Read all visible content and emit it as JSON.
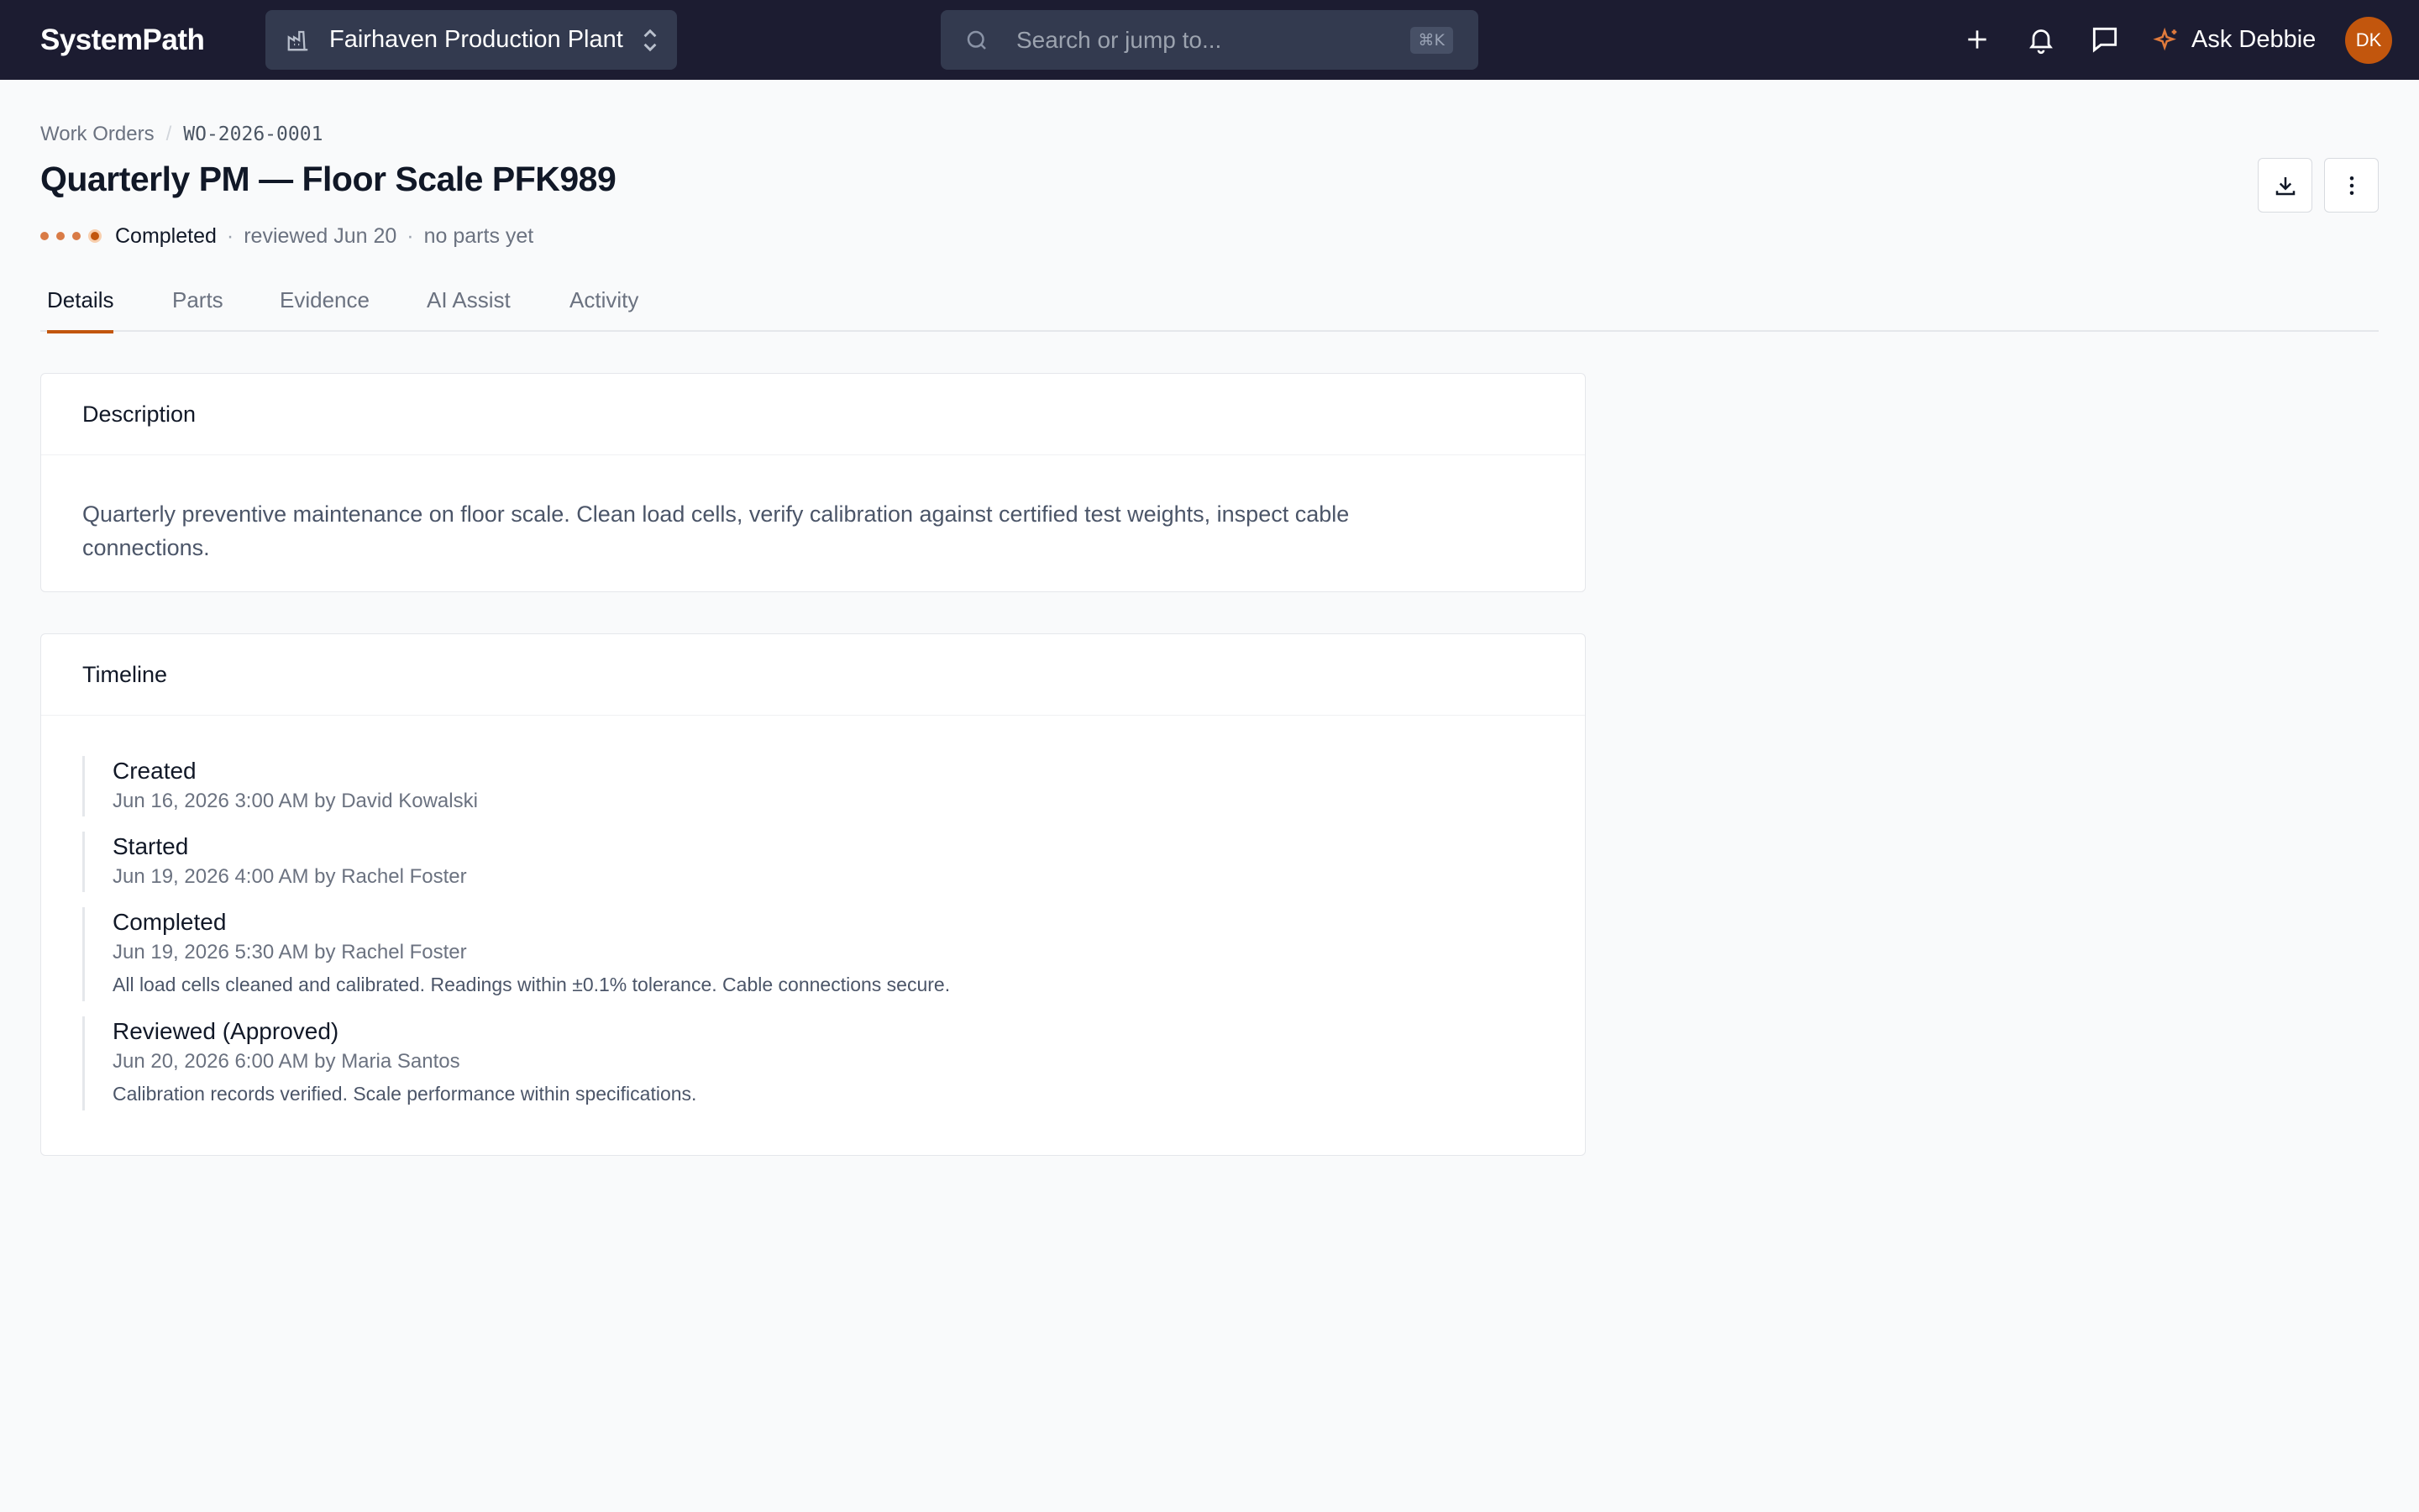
{
  "nav": {
    "brand": "SystemPath",
    "plant": "Fairhaven Production Plant",
    "search_placeholder": "Search or jump to...",
    "search_shortcut": "⌘K",
    "ask_label": "Ask Debbie",
    "avatar_initials": "DK",
    "icons": [
      "plus-icon",
      "bell-icon",
      "chat-icon",
      "sparkle-icon"
    ]
  },
  "breadcrumb": {
    "parent": "Work Orders",
    "separator": "/",
    "current": "WO-2026-0001"
  },
  "header": {
    "title": "Quarterly PM — Floor Scale PFK989",
    "status": "Completed",
    "separator": "·",
    "reviewed": "reviewed Jun 20",
    "parts": "no parts yet",
    "progress_steps_total": 4,
    "progress_steps_done": 4
  },
  "tabs": [
    {
      "label": "Details",
      "active": true
    },
    {
      "label": "Parts",
      "active": false
    },
    {
      "label": "Evidence",
      "active": false
    },
    {
      "label": "AI Assist",
      "active": false
    },
    {
      "label": "Activity",
      "active": false
    }
  ],
  "description": {
    "heading": "Description",
    "text": "Quarterly preventive maintenance on floor scale. Clean load cells, verify calibration against certified test weights, inspect cable connections."
  },
  "timeline": {
    "heading": "Timeline",
    "events": [
      {
        "title": "Created",
        "meta": "Jun 16, 2026 3:00 AM by David Kowalski",
        "note": ""
      },
      {
        "title": "Started",
        "meta": "Jun 19, 2026 4:00 AM by Rachel Foster",
        "note": ""
      },
      {
        "title": "Completed",
        "meta": "Jun 19, 2026 5:30 AM by Rachel Foster",
        "note": "All load cells cleaned and calibrated. Readings within ±0.1% tolerance. Cable connections secure."
      },
      {
        "title": "Reviewed (Approved)",
        "meta": "Jun 20, 2026 6:00 AM by Maria Santos",
        "note": "Calibration records verified. Scale performance within specifications."
      }
    ]
  },
  "colors": {
    "nav_bg": "#1c1c31",
    "accent": "#c2560d",
    "page_bg": "#f9fafb"
  }
}
